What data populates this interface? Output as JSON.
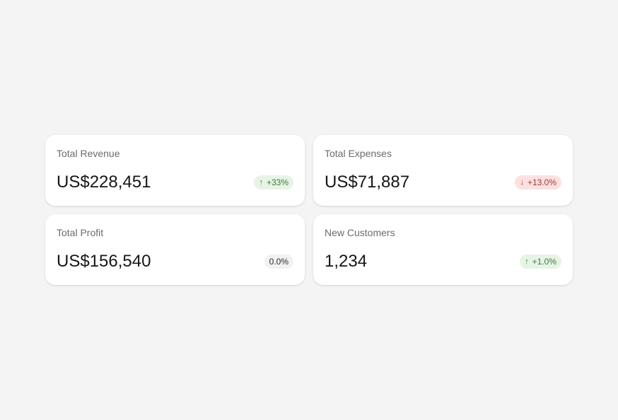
{
  "colors": {
    "background": "#f4f4f4",
    "card": "#ffffff",
    "positive": "#3b7a36",
    "negative": "#a33a36",
    "neutral": "#2a2a2a"
  },
  "metrics": [
    {
      "title": "Total Revenue",
      "value": "US$228,451",
      "change": "+33%",
      "trend": "up",
      "arrow_icon": "↑"
    },
    {
      "title": "Total Expenses",
      "value": "US$71,887",
      "change": "+13.0%",
      "trend": "down",
      "arrow_icon": "↓"
    },
    {
      "title": "Total Profit",
      "value": "US$156,540",
      "change": "0.0%",
      "trend": "neutral",
      "arrow_icon": ""
    },
    {
      "title": "New Customers",
      "value": "1,234",
      "change": "+1.0%",
      "trend": "up",
      "arrow_icon": "↑"
    }
  ]
}
